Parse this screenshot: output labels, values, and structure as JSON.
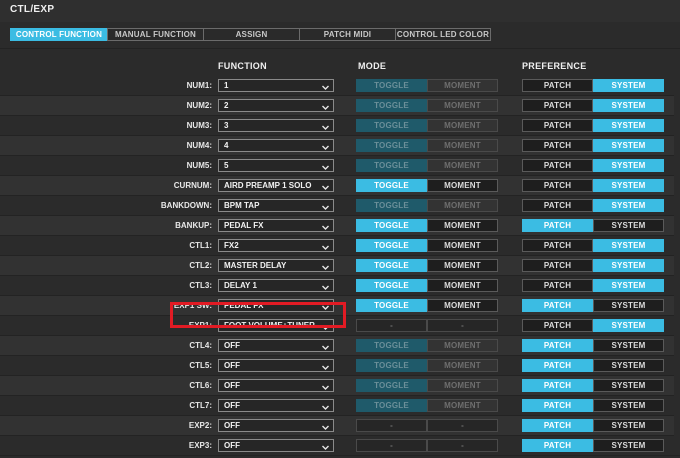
{
  "window": {
    "title": "CTL/EXP"
  },
  "tabs": [
    {
      "label": "CONTROL FUNCTION",
      "active": true
    },
    {
      "label": "MANUAL FUNCTION",
      "active": false
    },
    {
      "label": "ASSIGN",
      "active": false
    },
    {
      "label": "PATCH MIDI",
      "active": false
    },
    {
      "label": "CONTROL LED COLOR",
      "active": false
    }
  ],
  "headers": {
    "function": "FUNCTION",
    "mode": "MODE",
    "preference": "PREFERENCE"
  },
  "labels": {
    "toggle": "TOGGLE",
    "moment": "MOMENT",
    "patch": "PATCH",
    "system": "SYSTEM",
    "dash": "-"
  },
  "colors": {
    "accent": "#3bbce3",
    "highlight_box": "#e21b24",
    "background": "#2b2b2b"
  },
  "rows": [
    {
      "label": "NUM1:",
      "function": "1",
      "mode": "toggle",
      "mode_enabled": false,
      "preference": "system"
    },
    {
      "label": "NUM2:",
      "function": "2",
      "mode": "toggle",
      "mode_enabled": false,
      "preference": "system"
    },
    {
      "label": "NUM3:",
      "function": "3",
      "mode": "toggle",
      "mode_enabled": false,
      "preference": "system"
    },
    {
      "label": "NUM4:",
      "function": "4",
      "mode": "toggle",
      "mode_enabled": false,
      "preference": "system"
    },
    {
      "label": "NUM5:",
      "function": "5",
      "mode": "toggle",
      "mode_enabled": false,
      "preference": "system"
    },
    {
      "label": "CURNUM:",
      "function": "AIRD PREAMP 1 SOLO",
      "mode": "toggle",
      "mode_enabled": true,
      "preference": "system"
    },
    {
      "label": "BANKDOWN:",
      "function": "BPM TAP",
      "mode": "toggle",
      "mode_enabled": false,
      "preference": "system"
    },
    {
      "label": "BANKUP:",
      "function": "PEDAL FX",
      "mode": "toggle",
      "mode_enabled": true,
      "preference": "patch"
    },
    {
      "label": "CTL1:",
      "function": "FX2",
      "mode": "toggle",
      "mode_enabled": true,
      "preference": "system"
    },
    {
      "label": "CTL2:",
      "function": "MASTER DELAY",
      "mode": "toggle",
      "mode_enabled": true,
      "preference": "system"
    },
    {
      "label": "CTL3:",
      "function": "DELAY 1",
      "mode": "toggle",
      "mode_enabled": true,
      "preference": "system"
    },
    {
      "label": "EXP1 SW:",
      "function": "PEDAL FX",
      "mode": "toggle",
      "mode_enabled": true,
      "preference": "patch"
    },
    {
      "label": "EXP1:",
      "function": "FOOT VOLUME+TUNER",
      "mode": "none",
      "mode_enabled": false,
      "preference": "system"
    },
    {
      "label": "CTL4:",
      "function": "OFF",
      "mode": "toggle",
      "mode_enabled": false,
      "preference": "patch"
    },
    {
      "label": "CTL5:",
      "function": "OFF",
      "mode": "toggle",
      "mode_enabled": false,
      "preference": "patch"
    },
    {
      "label": "CTL6:",
      "function": "OFF",
      "mode": "toggle",
      "mode_enabled": false,
      "preference": "patch"
    },
    {
      "label": "CTL7:",
      "function": "OFF",
      "mode": "toggle",
      "mode_enabled": false,
      "preference": "patch"
    },
    {
      "label": "EXP2:",
      "function": "OFF",
      "mode": "none",
      "mode_enabled": false,
      "preference": "patch"
    },
    {
      "label": "EXP3:",
      "function": "OFF",
      "mode": "none",
      "mode_enabled": false,
      "preference": "patch"
    }
  ]
}
